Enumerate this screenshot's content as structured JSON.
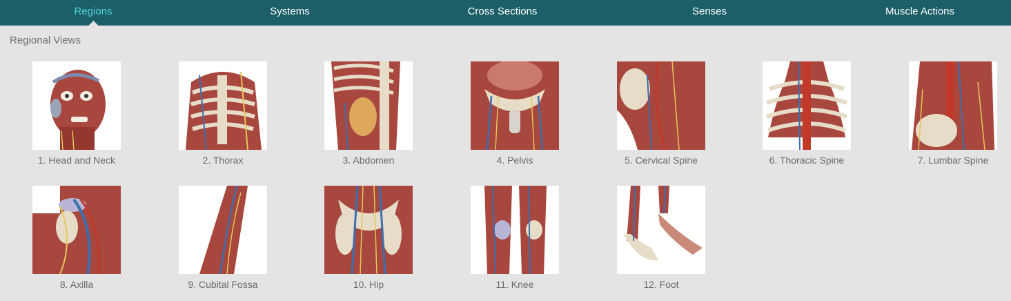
{
  "nav": {
    "tabs": [
      {
        "label": "Regions",
        "active": true
      },
      {
        "label": "Systems",
        "active": false
      },
      {
        "label": "Cross Sections",
        "active": false
      },
      {
        "label": "Senses",
        "active": false
      },
      {
        "label": "Muscle Actions",
        "active": false
      }
    ]
  },
  "section": {
    "title": "Regional Views"
  },
  "regions": [
    {
      "label": "1. Head and Neck"
    },
    {
      "label": "2. Thorax"
    },
    {
      "label": "3. Abdomen"
    },
    {
      "label": "4. Pelvis"
    },
    {
      "label": "5. Cervical Spine"
    },
    {
      "label": "6. Thoracic Spine"
    },
    {
      "label": "7. Lumbar Spine"
    },
    {
      "label": "8. Axilla"
    },
    {
      "label": "9. Cubital Fossa"
    },
    {
      "label": "10. Hip"
    },
    {
      "label": "11. Knee"
    },
    {
      "label": "12. Foot"
    }
  ],
  "colors": {
    "nav_bg": "#1c5f69",
    "nav_active": "#4fd3d9",
    "page_bg": "#e4e4e4",
    "muscle": "#a8473d",
    "bone": "#e6dcc8",
    "vessel_blue": "#3b6fb0",
    "vessel_red": "#c0392b",
    "nerve": "#e3c75a"
  }
}
